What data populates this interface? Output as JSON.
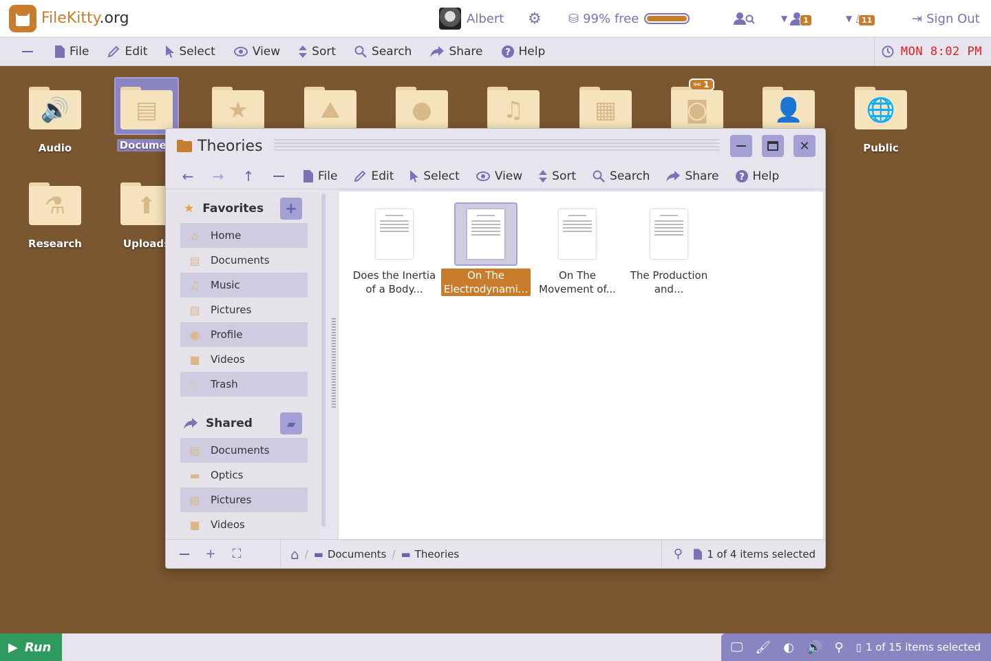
{
  "app": {
    "logo_name": "FileKitty",
    "logo_tld": ".org"
  },
  "topbar": {
    "user_name": "Albert",
    "storage_text": "99% free",
    "storage_used_fraction": 0.99,
    "notif_count_1": "1",
    "notif_count_2": "11",
    "signout_label": "Sign Out"
  },
  "menubar": {
    "file": "File",
    "edit": "Edit",
    "select": "Select",
    "view": "View",
    "sort": "Sort",
    "search": "Search",
    "share": "Share",
    "help": "Help",
    "clock": "MON 8:02 PM"
  },
  "desktop": {
    "icons": [
      {
        "label": "Audio"
      },
      {
        "label": "Documen"
      },
      {
        "label": ""
      },
      {
        "label": ""
      },
      {
        "label": ""
      },
      {
        "label": ""
      },
      {
        "label": ""
      },
      {
        "label": ""
      },
      {
        "label": ""
      },
      {
        "label": "Public"
      },
      {
        "label": "Research"
      },
      {
        "label": "Uploads"
      }
    ],
    "share_badge": "1"
  },
  "window": {
    "title": "Theories",
    "menu": {
      "file": "File",
      "edit": "Edit",
      "select": "Select",
      "view": "View",
      "sort": "Sort",
      "search": "Search",
      "share": "Share",
      "help": "Help"
    },
    "sidebar": {
      "favorites_header": "Favorites",
      "favorites": [
        "Home",
        "Documents",
        "Music",
        "Pictures",
        "Profile",
        "Videos",
        "Trash"
      ],
      "shared_header": "Shared",
      "shared": [
        "Documents",
        "Optics",
        "Pictures",
        "Videos"
      ]
    },
    "files": [
      {
        "name_line1": "Does the Inertia",
        "name_line2": "of a Body..."
      },
      {
        "name_line1": "On The",
        "name_line2": "Electrodynami..."
      },
      {
        "name_line1": "On The",
        "name_line2": "Movement of..."
      },
      {
        "name_line1": "The Production",
        "name_line2": "and..."
      }
    ],
    "breadcrumb": [
      "Documents",
      "Theories"
    ],
    "status": "1 of 4 items selected"
  },
  "bottombar": {
    "run_label": "Run",
    "status": "1 of 15 items selected"
  },
  "colors": {
    "accent": "#c77d2c",
    "purple": "#7a72b5",
    "desktop": "#7a5631",
    "run_green": "#2e9a5e",
    "clock_red": "#e02020"
  }
}
